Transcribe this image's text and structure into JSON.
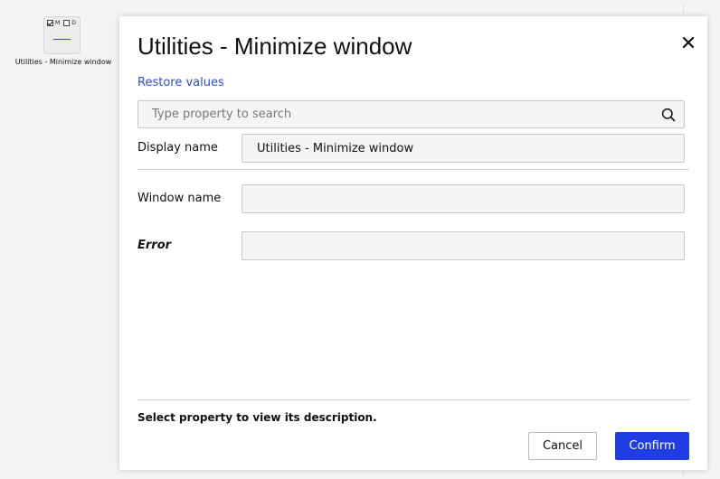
{
  "canvas": {
    "node_checkbox_m_label": "M",
    "node_checkbox_d_label": "D",
    "node_label": "Utilities - Minimize window"
  },
  "dialog": {
    "title": "Utilities - Minimize window",
    "close_icon": "close-icon",
    "restore_link": "Restore values",
    "search": {
      "placeholder": "Type property to search",
      "value": "",
      "icon": "search-icon"
    },
    "properties": [
      {
        "label": "Display name",
        "value": "Utilities - Minimize window"
      },
      {
        "label": "Window name",
        "value": ""
      },
      {
        "label": "Error",
        "value": ""
      }
    ],
    "description": "Select property to view its description.",
    "cancel_label": "Cancel",
    "confirm_label": "Confirm",
    "colors": {
      "accent": "#1f3de0",
      "link": "#2b4fc4"
    }
  }
}
